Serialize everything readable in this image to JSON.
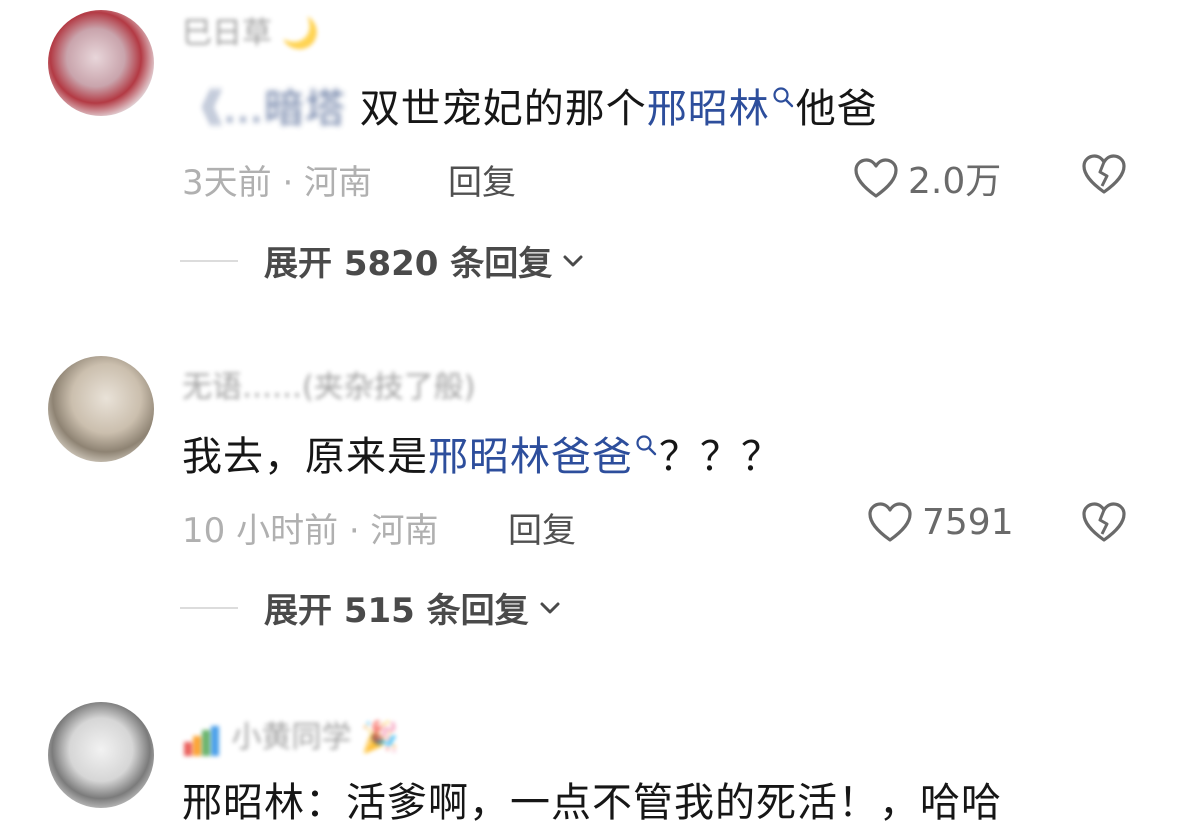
{
  "comments": [
    {
      "username": "巳日草",
      "username_emoji": "🌙",
      "text_blurred": "《…暗塔",
      "text_plain": " 双世宠妃的那个",
      "text_link": "邢昭林",
      "text_after": "他爸",
      "time_location": "3天前 · 河南",
      "reply_label": "回复",
      "like_count": "2.0万",
      "expand_label": "展开 5820 条回复"
    },
    {
      "username": "无语……(夹杂技了般)",
      "username_emoji": "",
      "text_plain": "我去，原来是",
      "text_link": "邢昭林爸爸",
      "text_after": "？？？",
      "time_location": "10 小时前 · 河南",
      "reply_label": "回复",
      "like_count": "7591",
      "expand_label": "展开 515 条回复"
    },
    {
      "username": "小黄同学",
      "username_emoji": "🎉",
      "text_plain": "邢昭林：活爹啊，一点不管我的死活！，哈哈"
    }
  ],
  "colors": {
    "link": "#2d4e9c",
    "meta": "#b0b0b0"
  },
  "icons": {
    "like": "heart-outline-icon",
    "dislike": "broken-heart-icon",
    "search": "search-icon",
    "expand": "chevron-down-icon"
  }
}
